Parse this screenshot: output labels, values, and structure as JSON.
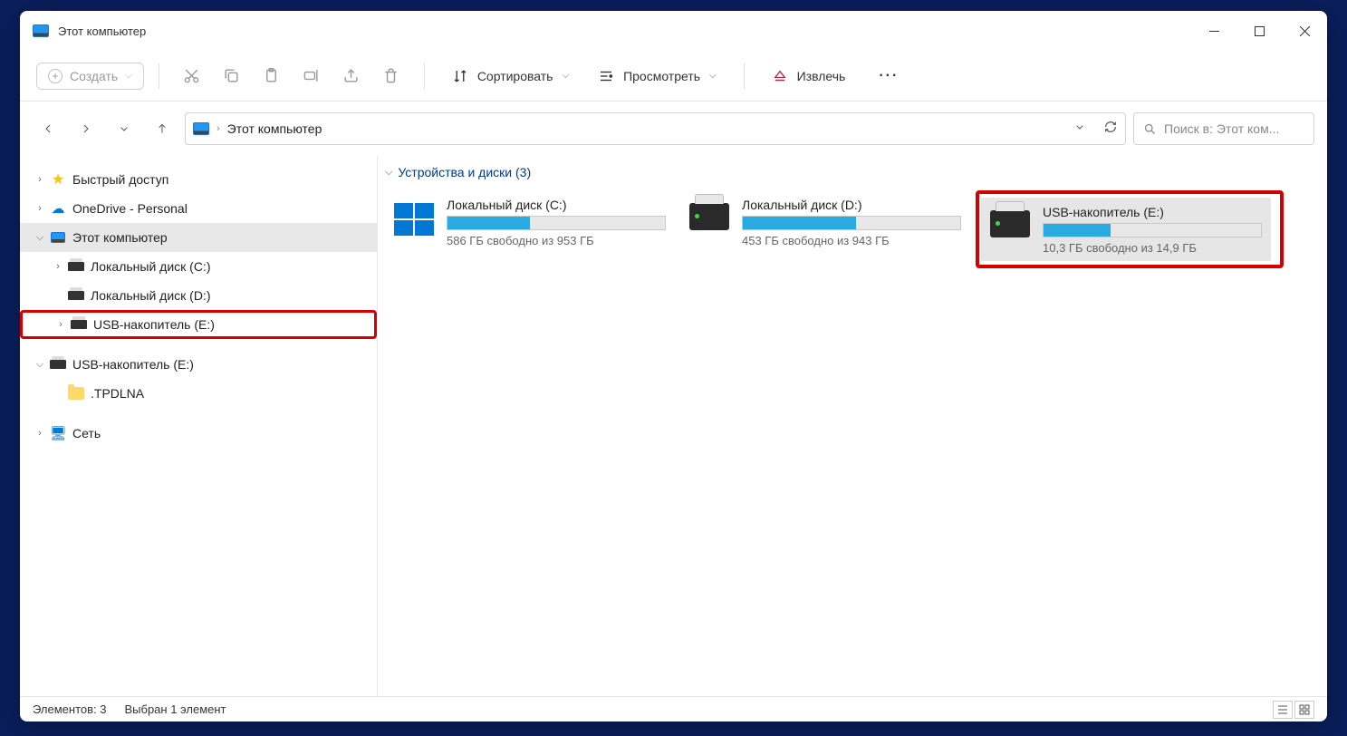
{
  "titlebar": {
    "title": "Этот компьютер"
  },
  "toolbar": {
    "new_label": "Создать",
    "sort_label": "Сортировать",
    "view_label": "Просмотреть",
    "eject_label": "Извлечь"
  },
  "address": {
    "location": "Этот компьютер"
  },
  "search": {
    "placeholder": "Поиск в: Этот ком..."
  },
  "sidebar": {
    "items": [
      {
        "label": "Быстрый доступ",
        "indent": 0,
        "arrow": ">",
        "icon": "star"
      },
      {
        "label": "OneDrive - Personal",
        "indent": 0,
        "arrow": ">",
        "icon": "cloud"
      },
      {
        "label": "Этот компьютер",
        "indent": 0,
        "arrow": "v",
        "icon": "pc",
        "selected": true
      },
      {
        "label": "Локальный диск (C:)",
        "indent": 1,
        "arrow": ">",
        "icon": "hdd"
      },
      {
        "label": "Локальный диск (D:)",
        "indent": 1,
        "arrow": "",
        "icon": "hdd"
      },
      {
        "label": "USB-накопитель (E:)",
        "indent": 1,
        "arrow": ">",
        "icon": "hdd",
        "highlight": true
      },
      {
        "label": "USB-накопитель (E:)",
        "indent": 0,
        "arrow": "v",
        "icon": "hdd"
      },
      {
        "label": ".TPDLNA",
        "indent": 1,
        "arrow": "",
        "icon": "folder"
      },
      {
        "label": "Сеть",
        "indent": 0,
        "arrow": ">",
        "icon": "net"
      }
    ]
  },
  "content": {
    "group_header": "Устройства и диски (3)",
    "drives": [
      {
        "name": "Локальный диск (C:)",
        "free_text": "586 ГБ свободно из 953 ГБ",
        "fill_percent": 38,
        "icon": "winlogo"
      },
      {
        "name": "Локальный диск (D:)",
        "free_text": "453 ГБ свободно из 943 ГБ",
        "fill_percent": 52,
        "icon": "hdd"
      },
      {
        "name": "USB-накопитель (E:)",
        "free_text": "10,3 ГБ свободно из 14,9 ГБ",
        "fill_percent": 31,
        "icon": "hdd",
        "selected": true,
        "highlight": true
      }
    ]
  },
  "statusbar": {
    "count_label": "Элементов: 3",
    "selection_label": "Выбран 1 элемент"
  }
}
